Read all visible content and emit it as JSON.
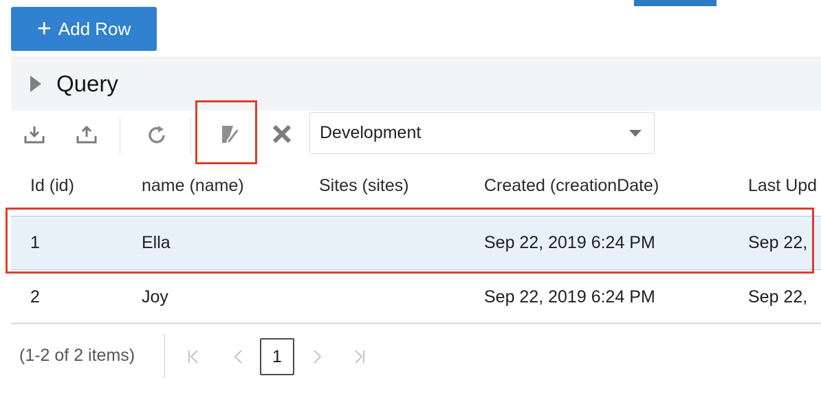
{
  "toolbar": {
    "add_row_label": "Add Row",
    "environment_value": "Development"
  },
  "query_panel": {
    "label": "Query"
  },
  "table": {
    "columns": [
      "Id (id)",
      "name (name)",
      "Sites (sites)",
      "Created (creationDate)",
      "Last Upd"
    ],
    "rows": [
      {
        "id": "1",
        "name": "Ella",
        "sites": "",
        "created": "Sep 22, 2019 6:24 PM",
        "last_updated": "Sep 22,"
      },
      {
        "id": "2",
        "name": "Joy",
        "sites": "",
        "created": "Sep 22, 2019 6:24 PM",
        "last_updated": "Sep 22,"
      }
    ]
  },
  "pager": {
    "summary": "(1-2 of 2 items)",
    "current_page": "1"
  },
  "colors": {
    "accent": "#3081d0",
    "highlight": "#d9402b",
    "selected_row": "#e8f1fa"
  }
}
